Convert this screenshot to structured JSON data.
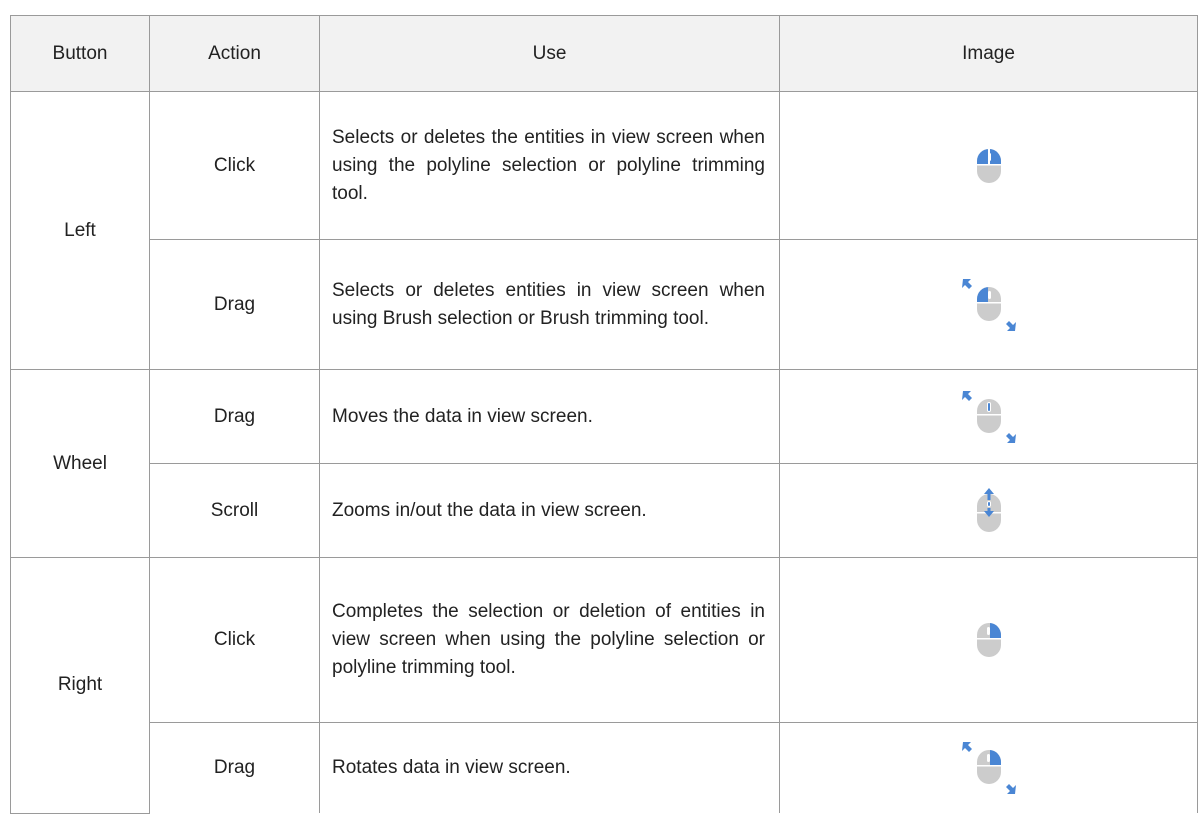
{
  "headers": {
    "button": "Button",
    "action": "Action",
    "use": "Use",
    "image": "Image"
  },
  "rows": [
    {
      "button": "Left",
      "action": "Click",
      "use": "Selects or deletes the entities in view screen when using the polyline selection or polyline trimming tool.",
      "icon": "mouse-left-click-icon"
    },
    {
      "button": "",
      "action": "Drag",
      "use": "Selects or deletes entities in view screen when using Brush selection or Brush trimming tool.",
      "icon": "mouse-left-drag-icon"
    },
    {
      "button": "Wheel",
      "action": "Drag",
      "use": "Moves the data in view screen.",
      "icon": "mouse-wheel-drag-icon"
    },
    {
      "button": "",
      "action": "Scroll",
      "use": "Zooms in/out the data in view screen.",
      "icon": "mouse-wheel-scroll-icon"
    },
    {
      "button": "Right",
      "action": "Click",
      "use": "Completes the selection or deletion of entities in view screen when using the polyline selection or polyline trimming tool.",
      "icon": "mouse-right-click-icon"
    },
    {
      "button": "",
      "action": "Drag",
      "use": "Rotates data in view screen.",
      "icon": "mouse-right-drag-icon"
    }
  ],
  "colors": {
    "accent": "#4a86d4",
    "mouse_body": "#cccccc",
    "header_bg": "#f2f2f2",
    "border": "#9a9a9a"
  }
}
